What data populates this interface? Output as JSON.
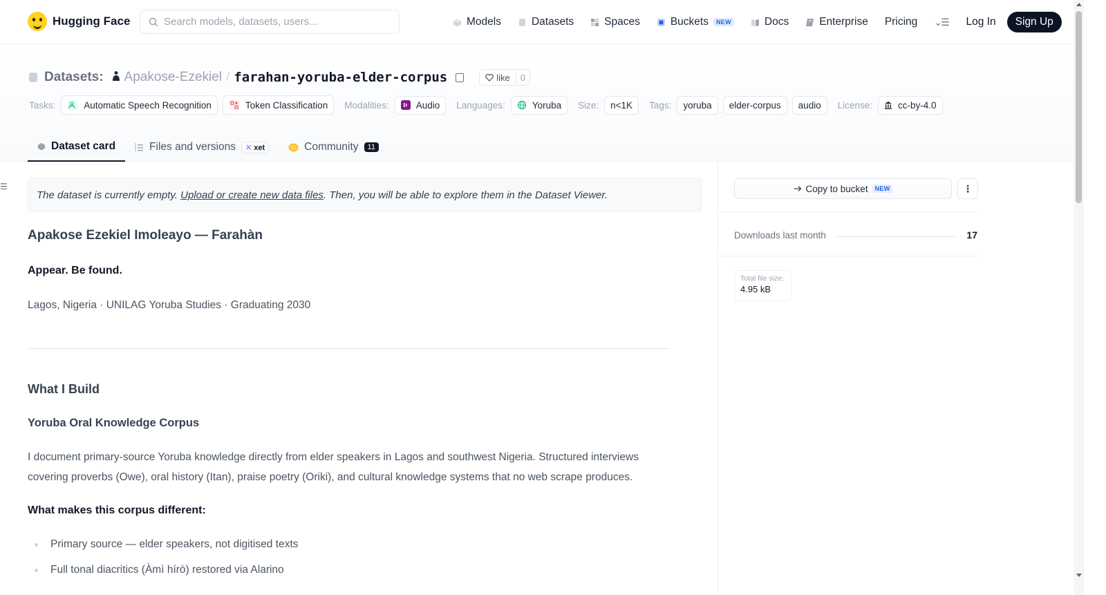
{
  "nav": {
    "brand": "Hugging Face",
    "search_placeholder": "Search models, datasets, users...",
    "links": [
      {
        "label": "Models",
        "icon": "cube-icon"
      },
      {
        "label": "Datasets",
        "icon": "database-icon"
      },
      {
        "label": "Spaces",
        "icon": "grid-icon"
      },
      {
        "label": "Buckets",
        "icon": "bucket-icon",
        "badge": "NEW"
      },
      {
        "label": "Docs",
        "icon": "book-icon"
      },
      {
        "label": "Enterprise",
        "icon": "enterprise-icon"
      },
      {
        "label": "Pricing"
      }
    ],
    "login": "Log In",
    "signup": "Sign Up"
  },
  "repo": {
    "type_label": "Datasets:",
    "owner": "Apakose-Ezekiel",
    "separator": "/",
    "name": "farahan-yoruba-elder-corpus",
    "like_label": "like",
    "like_count": "0"
  },
  "tags": {
    "tasks_label": "Tasks:",
    "tasks": [
      "Automatic Speech Recognition",
      "Token Classification"
    ],
    "modalities_label": "Modalities:",
    "modality": "Audio",
    "languages_label": "Languages:",
    "language": "Yoruba",
    "size_label": "Size:",
    "size": "n<1K",
    "tags_label": "Tags:",
    "tag_list": [
      "yoruba",
      "elder-corpus",
      "audio"
    ],
    "license_label": "License:",
    "license": "cc-by-4.0"
  },
  "tabs": {
    "card": "Dataset card",
    "files": "Files and versions",
    "xet": "xet",
    "community": "Community",
    "community_count": "11"
  },
  "content": {
    "notice_prefix": "The dataset is currently empty. ",
    "notice_link": "Upload or create new data files",
    "notice_suffix": ". Then, you will be able to explore them in the Dataset Viewer.",
    "name_heading": "Apakose Ezekiel Imoleayo — Farahàn",
    "tagline": "Appear. Be found.",
    "location": "Lagos, Nigeria · UNILAG Yoruba Studies · Graduating 2030",
    "build_heading": "What I Build",
    "corpus_heading": "Yoruba Oral Knowledge Corpus",
    "description": "I document primary-source Yoruba knowledge directly from elder speakers in Lagos and southwest Nigeria. Structured interviews covering proverbs (Owe), oral history (Itan), praise poetry (Oriki), and cultural knowledge systems that no web scrape produces.",
    "diff_heading": "What makes this corpus different:",
    "points": [
      "Primary source — elder speakers, not digitised texts",
      "Full tonal diacritics (Àmì hírò) restored via Alarino"
    ]
  },
  "sidebar": {
    "copy_label": "Copy to bucket",
    "copy_badge": "NEW",
    "downloads_label": "Downloads last month",
    "downloads_value": "17",
    "size_label": "Total file size:",
    "size_value": "4.95 kB"
  },
  "colors": {
    "brand_yellow": "#ffd21e",
    "signup_bg": "#0b1324",
    "new_badge": "#2563eb"
  }
}
